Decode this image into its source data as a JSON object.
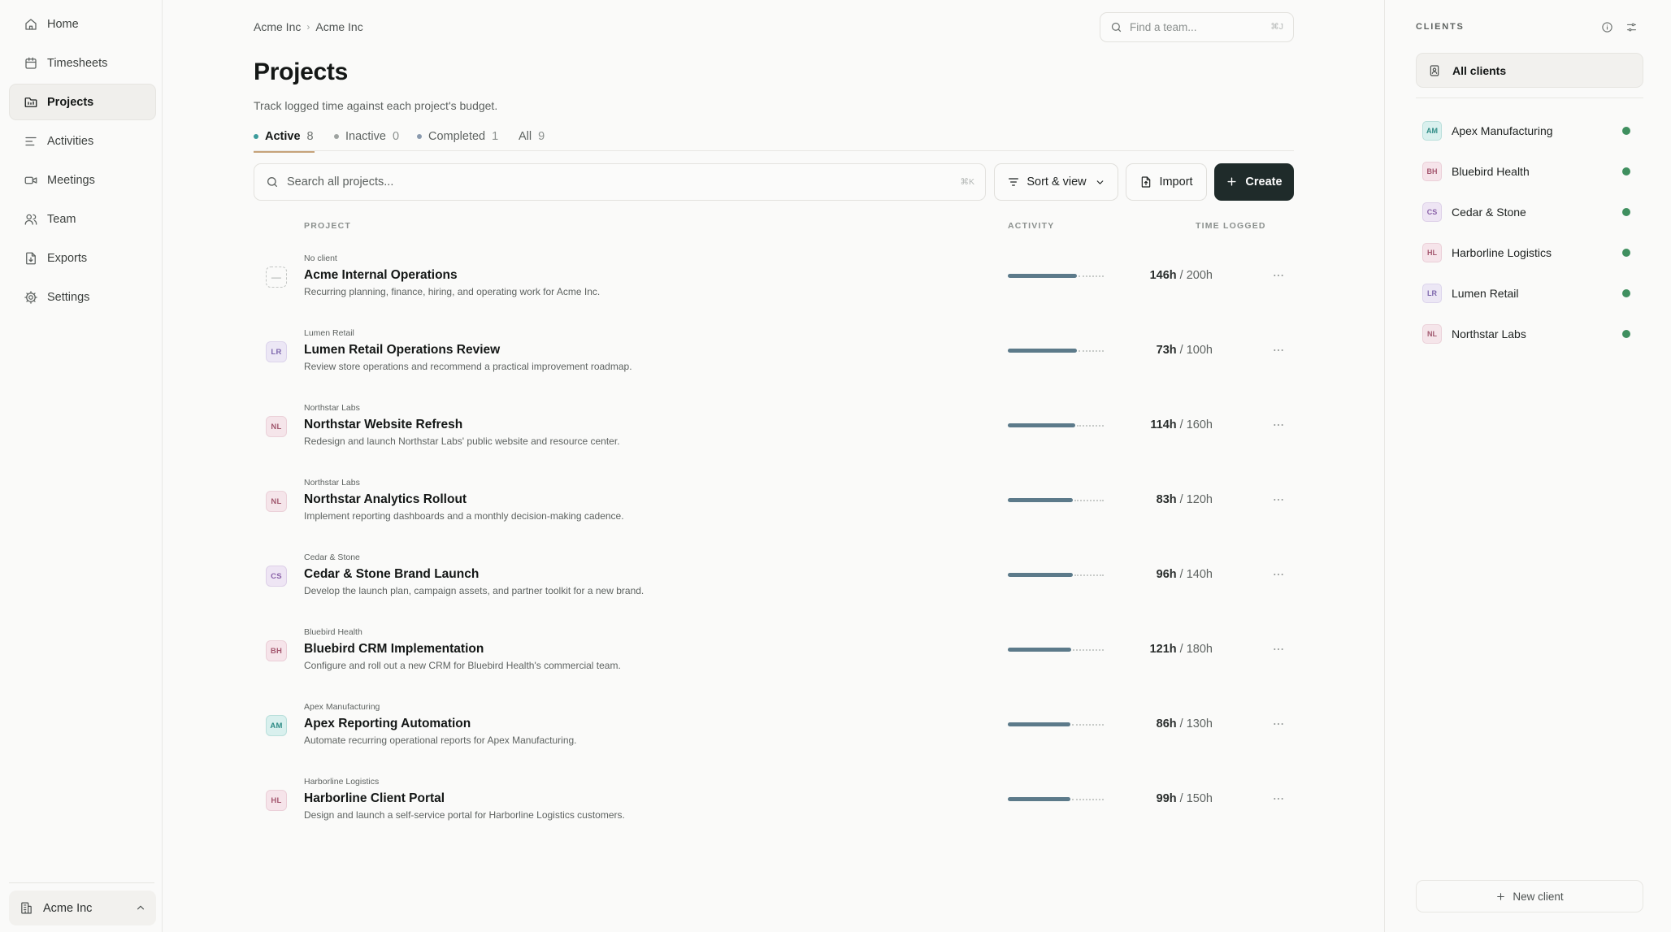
{
  "sidebar": {
    "items": [
      {
        "label": "Home",
        "icon": "home-icon"
      },
      {
        "label": "Timesheets",
        "icon": "calendar-icon"
      },
      {
        "label": "Projects",
        "icon": "folder-icon",
        "active": true
      },
      {
        "label": "Activities",
        "icon": "list-icon"
      },
      {
        "label": "Meetings",
        "icon": "video-icon"
      },
      {
        "label": "Team",
        "icon": "users-icon"
      },
      {
        "label": "Exports",
        "icon": "file-export-icon"
      },
      {
        "label": "Settings",
        "icon": "gear-icon"
      }
    ],
    "workspace": {
      "label": "Acme Inc",
      "icon": "building-icon"
    }
  },
  "breadcrumb": {
    "items": [
      "Acme Inc",
      "Acme Inc"
    ],
    "separator": "›"
  },
  "team_search": {
    "placeholder": "Find a team...",
    "shortcut": "⌘J"
  },
  "page": {
    "title": "Projects",
    "subtitle": "Track logged time against each project's budget."
  },
  "tabs": [
    {
      "label": "Active",
      "count": "8",
      "dot_color": "#3b9b9b",
      "active": true
    },
    {
      "label": "Inactive",
      "count": "0",
      "dot_color": "#9ea3a1"
    },
    {
      "label": "Completed",
      "count": "1",
      "dot_color": "#8a9aae"
    },
    {
      "label": "All",
      "count": "9"
    }
  ],
  "toolbar": {
    "search_placeholder": "Search all projects...",
    "search_shortcut": "⌘K",
    "sort_label": "Sort & view",
    "import_label": "Import",
    "create_label": "Create"
  },
  "table": {
    "headers": {
      "project": "PROJECT",
      "activity": "ACTIVITY",
      "time": "TIME LOGGED"
    },
    "rows": [
      {
        "initials": "—",
        "client": "No client",
        "name": "Acme Internal Operations",
        "description": "Recurring planning, finance, hiring, and operating work for Acme Inc.",
        "logged": "146h",
        "budget": "/ 200h",
        "activity": 0.73
      },
      {
        "initials": "LR",
        "client": "Lumen Retail",
        "name": "Lumen Retail Operations Review",
        "description": "Review store operations and recommend a practical improvement roadmap.",
        "logged": "73h",
        "budget": "/ 100h",
        "activity": 0.73
      },
      {
        "initials": "NL",
        "client": "Northstar Labs",
        "name": "Northstar Website Refresh",
        "description": "Redesign and launch Northstar Labs' public website and resource center.",
        "logged": "114h",
        "budget": "/ 160h",
        "activity": 0.71
      },
      {
        "initials": "NL",
        "client": "Northstar Labs",
        "name": "Northstar Analytics Rollout",
        "description": "Implement reporting dashboards and a monthly decision-making cadence.",
        "logged": "83h",
        "budget": "/ 120h",
        "activity": 0.69
      },
      {
        "initials": "CS",
        "client": "Cedar & Stone",
        "name": "Cedar & Stone Brand Launch",
        "description": "Develop the launch plan, campaign assets, and partner toolkit for a new brand.",
        "logged": "96h",
        "budget": "/ 140h",
        "activity": 0.69
      },
      {
        "initials": "BH",
        "client": "Bluebird Health",
        "name": "Bluebird CRM Implementation",
        "description": "Configure and roll out a new CRM for Bluebird Health's commercial team.",
        "logged": "121h",
        "budget": "/ 180h",
        "activity": 0.67
      },
      {
        "initials": "AM",
        "client": "Apex Manufacturing",
        "name": "Apex Reporting Automation",
        "description": "Automate recurring operational reports for Apex Manufacturing.",
        "logged": "86h",
        "budget": "/ 130h",
        "activity": 0.66
      },
      {
        "initials": "HL",
        "client": "Harborline Logistics",
        "name": "Harborline Client Portal",
        "description": "Design and launch a self-service portal for Harborline Logistics customers.",
        "logged": "99h",
        "budget": "/ 150h",
        "activity": 0.66
      }
    ]
  },
  "clients_panel": {
    "title": "CLIENTS",
    "all_label": "All clients",
    "clients": [
      {
        "initials": "AM",
        "name": "Apex Manufacturing",
        "status_color": "#3f8f5f"
      },
      {
        "initials": "BH",
        "name": "Bluebird Health",
        "status_color": "#3f8f5f"
      },
      {
        "initials": "CS",
        "name": "Cedar & Stone",
        "status_color": "#3f8f5f"
      },
      {
        "initials": "HL",
        "name": "Harborline Logistics",
        "status_color": "#3f8f5f"
      },
      {
        "initials": "LR",
        "name": "Lumen Retail",
        "status_color": "#3f8f5f"
      },
      {
        "initials": "NL",
        "name": "Northstar Labs",
        "status_color": "#3f8f5f"
      }
    ],
    "new_client_label": "New client"
  },
  "avatar_colors": {
    "AM": {
      "bg": "#d9f0ee",
      "fg": "#2f8c86",
      "border": "#b9dfdb"
    },
    "BH": {
      "bg": "#f6e4ea",
      "fg": "#a4576f",
      "border": "#ebcfd8"
    },
    "CS": {
      "bg": "#eee5f4",
      "fg": "#8a62a8",
      "border": "#ddd0e8"
    },
    "HL": {
      "bg": "#f6e4ea",
      "fg": "#a4576f",
      "border": "#ebcfd8"
    },
    "LR": {
      "bg": "#ece7f5",
      "fg": "#7e68ad",
      "border": "#dcd4ec"
    },
    "NL": {
      "bg": "#f5e5ea",
      "fg": "#a25a70",
      "border": "#ebd1d9"
    }
  }
}
